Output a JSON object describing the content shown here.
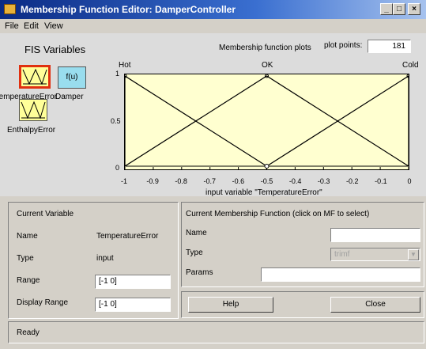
{
  "window": {
    "title": "Membership Function Editor: DamperController",
    "minimize": "_",
    "maximize": "□",
    "close": "×"
  },
  "menu": [
    "File",
    "Edit",
    "View"
  ],
  "fis": {
    "title": "FIS Variables",
    "input1_label": "TemperatureError",
    "output_label": "Damper",
    "output_box_text": "f(u)",
    "input2_label": "EnthalpyError"
  },
  "plot": {
    "caption": "Membership function plots",
    "points_label": "plot points:",
    "points_value": "181",
    "x_axis_label": "input variable \"TemperatureError\""
  },
  "chart_data": {
    "type": "line",
    "xlim": [
      -1,
      0
    ],
    "ylim": [
      0,
      1
    ],
    "x_ticks": [
      "-1",
      "-0.9",
      "-0.8",
      "-0.7",
      "-0.6",
      "-0.5",
      "-0.4",
      "-0.3",
      "-0.2",
      "-0.1",
      "0"
    ],
    "y_ticks": [
      "0",
      "0.5",
      "1"
    ],
    "series": [
      {
        "name": "Hot",
        "x": [
          -1,
          -1,
          -0.5
        ],
        "y": [
          0,
          1,
          0
        ]
      },
      {
        "name": "OK",
        "x": [
          -1,
          -0.5,
          0
        ],
        "y": [
          0,
          1,
          0
        ]
      },
      {
        "name": "Cold",
        "x": [
          -0.5,
          0,
          0
        ],
        "y": [
          0,
          1,
          0
        ]
      }
    ]
  },
  "current_variable": {
    "title": "Current Variable",
    "name_label": "Name",
    "name_value": "TemperatureError",
    "type_label": "Type",
    "type_value": "input",
    "range_label": "Range",
    "range_value": "[-1 0]",
    "display_range_label": "Display Range",
    "display_range_value": "[-1 0]"
  },
  "current_mf": {
    "title": "Current Membership Function (click on MF to select)",
    "name_label": "Name",
    "name_value": "",
    "type_label": "Type",
    "type_value": "trimf",
    "params_label": "Params",
    "params_value": ""
  },
  "buttons": {
    "help": "Help",
    "close": "Close"
  },
  "status": "Ready",
  "colors": {
    "plot_bg": "#ffffd0",
    "input_box": "#ffff99",
    "output_box": "#99ddee",
    "selected_border": "#e03010"
  }
}
